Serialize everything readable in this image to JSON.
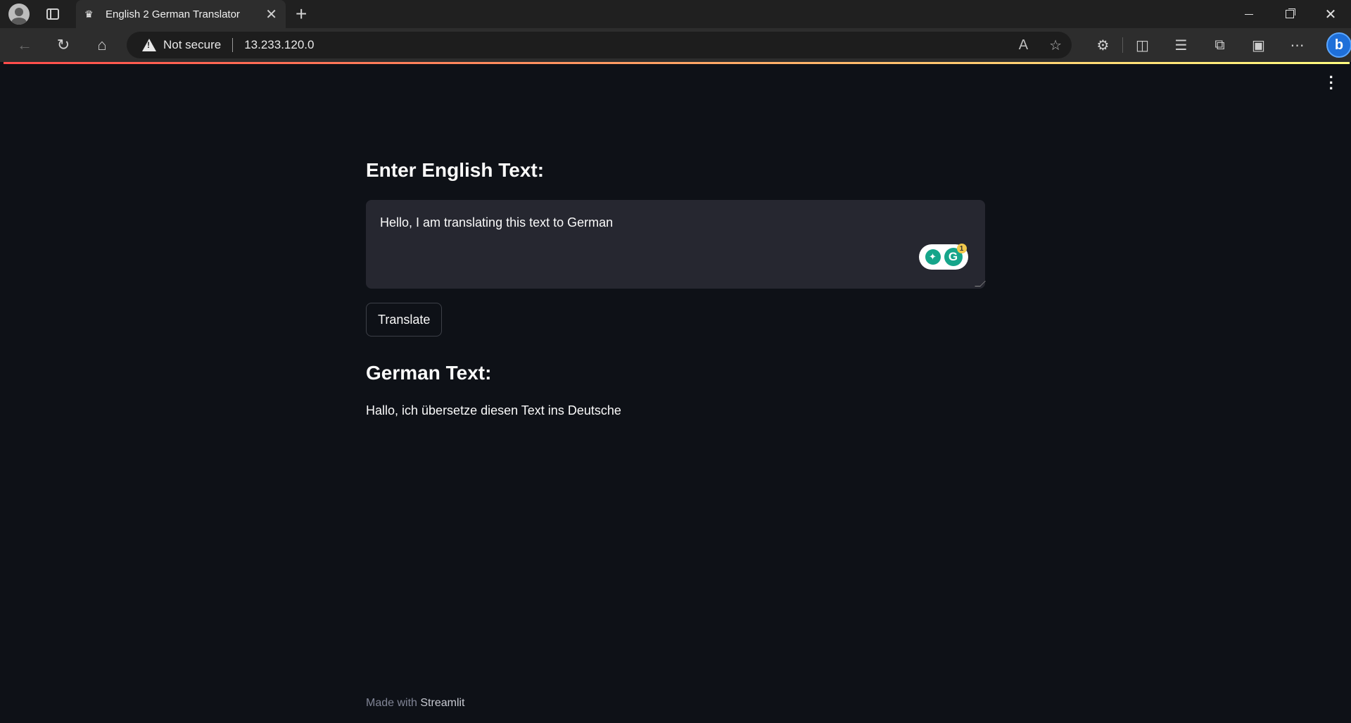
{
  "browser": {
    "tab_title": "English 2 German Translator",
    "tab_favicon": "streamlit-crown-icon",
    "security_label": "Not secure",
    "url": "13.233.120.0"
  },
  "app": {
    "input_heading": "Enter English Text:",
    "input_value": "Hello, I am translating this text to German",
    "translate_button": "Translate",
    "output_heading": "German Text:",
    "output_text": "Hallo, ich übersetze diesen Text ins Deutsche",
    "grammarly_badge_count": "1",
    "footer_prefix": "Made with",
    "footer_brand": "Streamlit"
  },
  "colors": {
    "background": "#0e1117",
    "input_bg": "#262730",
    "accent_gradient_start": "#ff4b4b",
    "accent_gradient_end": "#fffd80"
  }
}
